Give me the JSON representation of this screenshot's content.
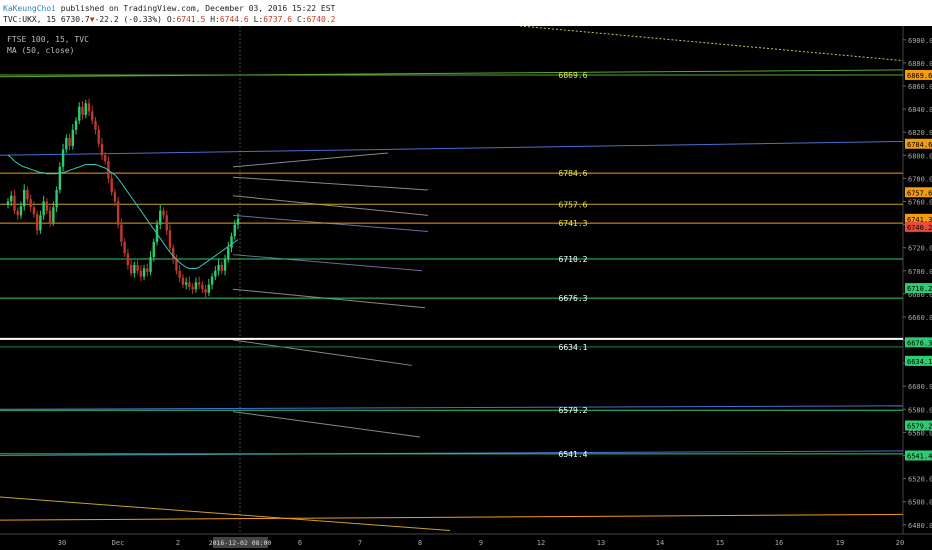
{
  "header": {
    "author": "KaKeungChoi",
    "published": " published on TradingView.com, December 03, 2016 15:22 EST",
    "symbol": "TVC:UKX, 15",
    "last": "6730.7",
    "down_arrow": "▼",
    "change": "-22.2 (-0.33%)",
    "o_label": "O:",
    "o": "6741.5",
    "h_label": "H:",
    "h": "6744.6",
    "l_label": "L:",
    "l": "6737.6",
    "c_label": "C:",
    "c": "6740.2"
  },
  "legend": {
    "line1": "FTSE 100, 15, TVC",
    "line2": "MA (50, close)"
  },
  "chart_data": {
    "type": "candlestick",
    "y_range": [
      6472,
      6912
    ],
    "y_ticks": [
      6900,
      6880,
      6860,
      6840,
      6820,
      6800,
      6780,
      6760,
      6740,
      6720,
      6700,
      6680,
      6660,
      6640,
      6620,
      6600,
      6580,
      6560,
      6540,
      6520,
      6500,
      6480
    ],
    "x_ticks": [
      "30",
      "Dec",
      "2",
      "6",
      "7",
      "8",
      "9",
      "12",
      "13",
      "14",
      "15",
      "16",
      "19",
      "20"
    ],
    "crosshair_label": "2016-12-02 08:00",
    "levels": [
      {
        "value": 6869.6,
        "label": "6869.6",
        "color": "#5aa832",
        "label_color": "#e8e84a",
        "axis_bg": "#f39c12"
      },
      {
        "value": 6784.6,
        "label": "6784.6",
        "color": "#f39c12",
        "label_color": "#e8e84a",
        "axis_bg": "#f39c12"
      },
      {
        "value": 6757.6,
        "label": "6757.6",
        "color": "#c9a227",
        "label_color": "#e8e84a",
        "axis_bg": "#f39c12"
      },
      {
        "value": 6741.3,
        "label": "6741.3",
        "color": "#f39c12",
        "label_color": "#e8e84a",
        "axis_bg": "#f39c12"
      },
      {
        "value": 6710.2,
        "label": "6710.2",
        "color": "#2ecc71",
        "label_color": "#ffffff",
        "axis_bg": "#2ecc71"
      },
      {
        "value": 6676.3,
        "label": "6676.3",
        "color": "#2ecc71",
        "label_color": "#ffffff",
        "axis_bg": "#2ecc71"
      },
      {
        "value": 6634.1,
        "label": "6634.1",
        "color": "#1e8449",
        "label_color": "#ffffff",
        "axis_bg": "#2ecc71"
      },
      {
        "value": 6579.2,
        "label": "6579.2",
        "color": "#2ecc71",
        "label_color": "#ffffff",
        "axis_bg": "#2ecc71"
      },
      {
        "value": 6541.4,
        "label": "6541.4",
        "color": "#2ecc71",
        "label_color": "#ffffff",
        "axis_bg": "#2ecc71"
      }
    ],
    "axis_labels": [
      {
        "value": 6869.6,
        "text": "6869.6",
        "bg": "#f39c12"
      },
      {
        "value": 6810.0,
        "text": "6784.6",
        "bg": "#f39c12"
      },
      {
        "value": 6768.0,
        "text": "6757.6",
        "bg": "#f39c12"
      },
      {
        "value": 6745.0,
        "text": "6741.3",
        "bg": "#f39c12"
      },
      {
        "value": 6738.0,
        "text": "6740.2",
        "bg": "#e74c3c"
      },
      {
        "value": 6685.0,
        "text": "6710.2",
        "bg": "#2ecc71"
      },
      {
        "value": 6638.0,
        "text": "6676.3",
        "bg": "#2ecc71"
      },
      {
        "value": 6622.0,
        "text": "6634.1",
        "bg": "#2ecc71"
      },
      {
        "value": 6566.0,
        "text": "6579.2",
        "bg": "#2ecc71"
      },
      {
        "value": 6540.0,
        "text": "6541.4",
        "bg": "#2ecc71"
      }
    ],
    "white_line": 6641,
    "price_series": [
      6760,
      6765,
      6752,
      6748,
      6756,
      6770,
      6762,
      6755,
      6749,
      6735,
      6748,
      6760,
      6752,
      6742,
      6755,
      6770,
      6790,
      6805,
      6815,
      6808,
      6822,
      6830,
      6842,
      6835,
      6845,
      6838,
      6830,
      6822,
      6810,
      6800,
      6795,
      6780,
      6768,
      6760,
      6740,
      6725,
      6715,
      6705,
      6698,
      6705,
      6700,
      6695,
      6702,
      6699,
      6712,
      6725,
      6740,
      6752,
      6748,
      6735,
      6720,
      6710,
      6700,
      6694,
      6688,
      6690,
      6686,
      6684,
      6690,
      6688,
      6684,
      6681,
      6688,
      6695,
      6700,
      6705,
      6700,
      6710,
      6720,
      6730,
      6740,
      6745
    ],
    "ma_series": [
      6800,
      6798,
      6795,
      6793,
      6791,
      6790,
      6789,
      6788,
      6787,
      6786,
      6785,
      6785,
      6784,
      6784,
      6784,
      6784,
      6785,
      6785,
      6786,
      6787,
      6788,
      6789,
      6790,
      6791,
      6792,
      6792,
      6792,
      6792,
      6791,
      6790,
      6789,
      6787,
      6785,
      6783,
      6780,
      6776,
      6772,
      6768,
      6764,
      6760,
      6756,
      6752,
      6748,
      6744,
      6740,
      6736,
      6732,
      6728,
      6724,
      6720,
      6716,
      6713,
      6710,
      6707,
      6705,
      6703,
      6702,
      6702,
      6702,
      6703,
      6705,
      6707,
      6709,
      6711,
      6713,
      6715,
      6717,
      6719,
      6721,
      6723,
      6725,
      6727
    ]
  }
}
